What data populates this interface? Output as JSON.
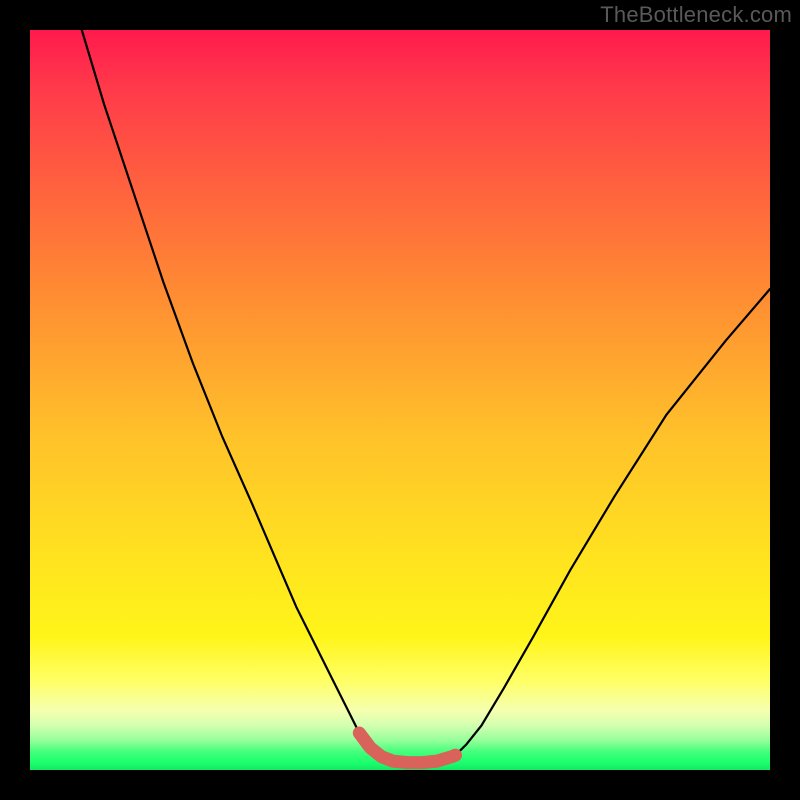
{
  "watermark": "TheBottleneck.com",
  "chart_data": {
    "type": "line",
    "title": "",
    "xlabel": "",
    "ylabel": "",
    "xlim": [
      0,
      100
    ],
    "ylim": [
      0,
      100
    ],
    "grid": false,
    "series": [
      {
        "name": "curve",
        "x": [
          7,
          10,
          14,
          18,
          22,
          26,
          30,
          33,
          36,
          39,
          41,
          43,
          44.5,
          46,
          47.5,
          49,
          51,
          53,
          55,
          57,
          57.5,
          59,
          61,
          64,
          68,
          73,
          79,
          86,
          94,
          100
        ],
        "values": [
          100,
          90,
          78,
          66,
          55,
          45,
          36,
          29,
          22,
          16,
          12,
          8,
          5,
          3,
          1.8,
          1.2,
          1,
          1,
          1.2,
          1.8,
          2,
          3.5,
          6,
          11,
          18,
          27,
          37,
          48,
          58,
          65
        ]
      }
    ],
    "highlight": {
      "name": "bottleneck-zone",
      "color": "#d9635a",
      "x": [
        44.5,
        46,
        47.5,
        49,
        51,
        53,
        55,
        57,
        57.5
      ],
      "values": [
        5,
        3,
        1.8,
        1.2,
        1,
        1,
        1.2,
        1.8,
        2
      ]
    },
    "background_gradient": {
      "top": "#ff1a4d",
      "middle": "#ffe41f",
      "bottom": "#14e865"
    }
  }
}
